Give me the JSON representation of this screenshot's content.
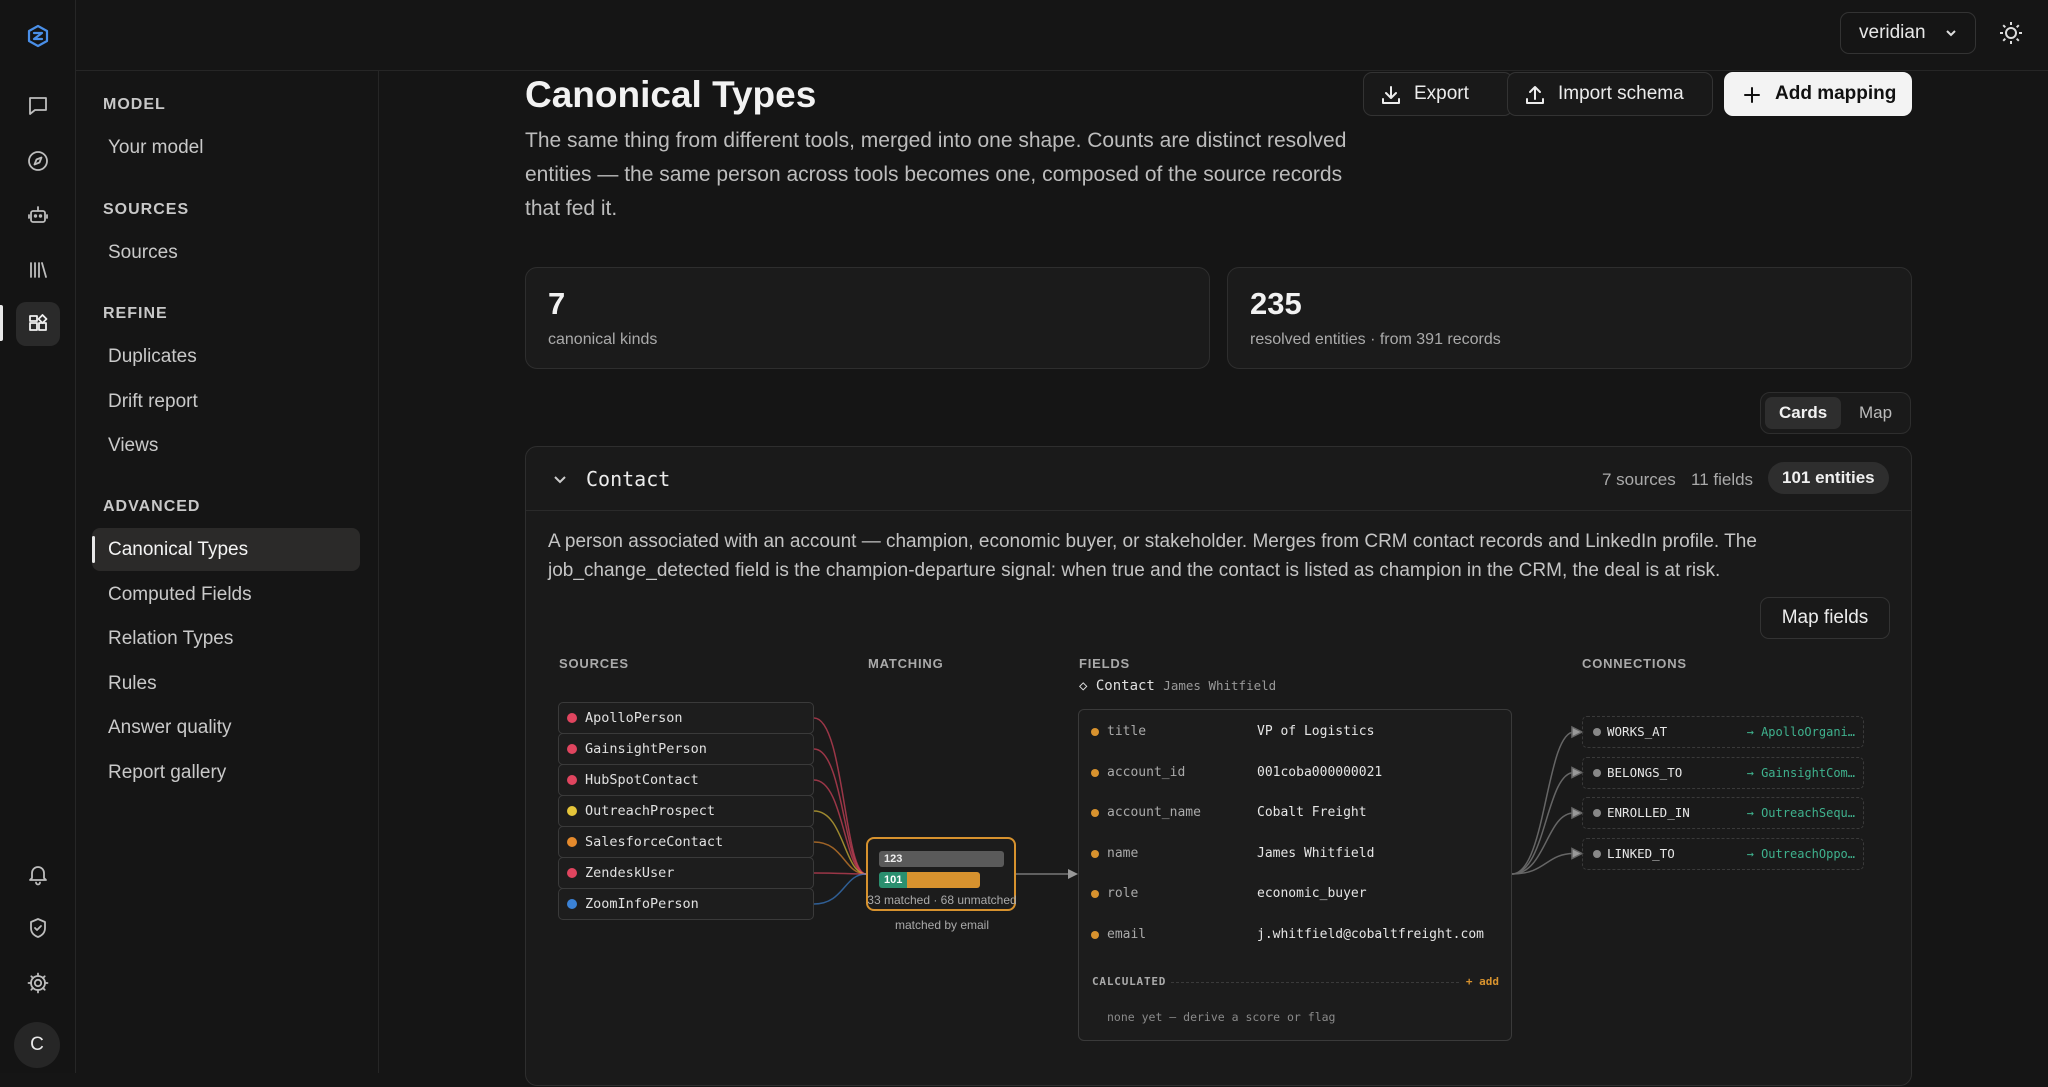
{
  "topbar": {
    "workspace": "veridian"
  },
  "rail": {
    "icons": [
      "logo-icon",
      "chat-icon",
      "compass-icon",
      "bot-icon",
      "library-icon",
      "grid-icon",
      "bell-icon",
      "shield-icon",
      "gear-icon"
    ],
    "avatar": "C"
  },
  "sidebar": {
    "sections": [
      {
        "title": "MODEL",
        "items": [
          "Your model"
        ]
      },
      {
        "title": "SOURCES",
        "items": [
          "Sources"
        ]
      },
      {
        "title": "REFINE",
        "items": [
          "Duplicates",
          "Drift report",
          "Views"
        ]
      },
      {
        "title": "ADVANCED",
        "items": [
          "Canonical Types",
          "Computed Fields",
          "Relation Types",
          "Rules",
          "Answer quality",
          "Report gallery"
        ]
      }
    ],
    "active": "Canonical Types"
  },
  "header": {
    "title": "Canonical Types",
    "description": "The same thing from different tools, merged into one shape. Counts are distinct resolved entities — the same person across tools becomes one, composed of the source records that fed it.",
    "buttons": {
      "export": "Export",
      "import": "Import schema",
      "add": "Add mapping"
    }
  },
  "stats": [
    {
      "value": "7",
      "label": "canonical kinds"
    },
    {
      "value": "235",
      "label": "resolved entities · from 391 records"
    }
  ],
  "view_toggle": {
    "cards": "Cards",
    "map": "Map",
    "selected": "Cards"
  },
  "card": {
    "name": "Contact",
    "sources_count": "7 sources",
    "fields_count": "11 fields",
    "entities": "101 entities",
    "description": "A person associated with an account — champion, economic buyer, or stakeholder. Merges from CRM contact records and LinkedIn profile. The job_change_detected field is the champion-departure signal: when true and the contact is listed as champion in the CRM, the deal is at risk.",
    "map_fields": "Map fields",
    "columns": {
      "sources": "SOURCES",
      "matching": "MATCHING",
      "fields": "FIELDS",
      "connections": "CONNECTIONS"
    },
    "sources": [
      {
        "name": "ApolloPerson",
        "color": "#e0455f"
      },
      {
        "name": "GainsightPerson",
        "color": "#e0455f"
      },
      {
        "name": "HubSpotContact",
        "color": "#e0455f"
      },
      {
        "name": "OutreachProspect",
        "color": "#e5c53a"
      },
      {
        "name": "SalesforceContact",
        "color": "#e58a2c"
      },
      {
        "name": "ZendeskUser",
        "color": "#e0455f"
      },
      {
        "name": "ZoomInfoPerson",
        "color": "#3b82d6"
      }
    ],
    "matching": {
      "total": "123",
      "matched": "101",
      "matched_fraction": 0.82,
      "summary": "33 matched · 68 unmatched",
      "method": "matched by email"
    },
    "fields_title": "◇ Contact",
    "fields_subject": "James Whitfield",
    "fields": [
      {
        "key": "title",
        "value": "VP of Logistics"
      },
      {
        "key": "account_id",
        "value": "001coba000000021"
      },
      {
        "key": "account_name",
        "value": "Cobalt Freight"
      },
      {
        "key": "name",
        "value": "James Whitfield"
      },
      {
        "key": "role",
        "value": "economic_buyer"
      },
      {
        "key": "email",
        "value": "j.whitfield@cobaltfreight.com"
      }
    ],
    "calculated_label": "CALCULATED",
    "calculated_add": "+ add",
    "calculated_none": "none yet — derive a score or flag",
    "connections": [
      {
        "rel": "WORKS_AT",
        "target": "→ ApolloOrgani…"
      },
      {
        "rel": "BELONGS_TO",
        "target": "→ GainsightCom…"
      },
      {
        "rel": "ENROLLED_IN",
        "target": "→ OutreachSequ…"
      },
      {
        "rel": "LINKED_TO",
        "target": "→ OutreachOppo…"
      }
    ]
  }
}
